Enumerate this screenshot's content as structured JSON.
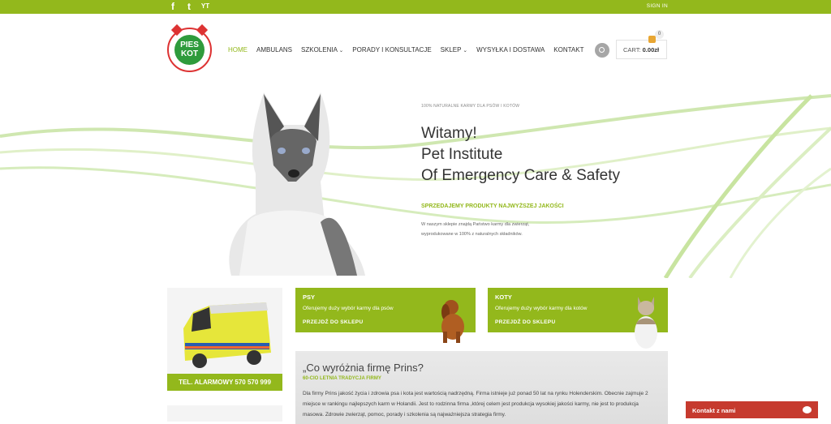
{
  "topbar": {
    "social": [
      "f",
      "t",
      "yt"
    ],
    "signin": "SIGN IN"
  },
  "logo": {
    "text_line1": "PIES",
    "text_line2": "KOT"
  },
  "nav": {
    "items": [
      "HOME",
      "AMBULANS",
      "SZKOLENIA",
      "PORADY I KONSULTACJE",
      "SKLEP",
      "WYSYŁKA I DOSTAWA",
      "KONTAKT"
    ],
    "arrow_on": [
      2,
      4
    ]
  },
  "cart": {
    "label": "CART:",
    "amount": "0.00zł",
    "count": "0"
  },
  "hero": {
    "subtitle": "100% NATURALNE KARMY DLA PSÓW I KOTÓW",
    "title1": "Witamy!",
    "title2": "Pet Institute",
    "title3": "Of Emergency Care & Safety",
    "green": "SPRZEDAJEMY PRODUKTY NAJWYŻSZEJ JAKOŚCI",
    "desc1": "W naszym sklepie znajdą Państwo karmy dla zwierząt,",
    "desc2": "wyprodukowane w 100% z naturalnych składników."
  },
  "ambulance": {
    "phone": "TEL. ALARMOWY 570 570 999"
  },
  "promo_psy": {
    "title": "PSY",
    "desc": "Oferujemy duży wybór karmy dla psów",
    "link": "PRZEJDŹ DO SKLEPU"
  },
  "promo_koty": {
    "title": "KOTY",
    "desc": "Oferujemy duży wybór karmy dla kotów",
    "link": "PRZEJDŹ DO SKLEPU"
  },
  "about": {
    "heading": "„Co wyróżnia firmę Prins?",
    "tagline": "60-CIO LETNIA TRADYCJA FIRMY",
    "text": "Dla firmy Prins jakość życia i zdrowia psa i kota jest wartością nadrzędną. Firma istnieje już ponad 50 lat na rynku Holenderskim. Obecnie zajmuje 2 miejsce w rankingu najlepszych karm w Holandii. Jest to rodzinna firma ,której celem jest produkcja wysokiej jakości karmy, nie jest to produkcja masowa. Zdrowie zwierząt, pomoc, porady i szkolenia są najważniejsza strategia firmy."
  },
  "contact": {
    "label": "Kontakt z nami"
  }
}
